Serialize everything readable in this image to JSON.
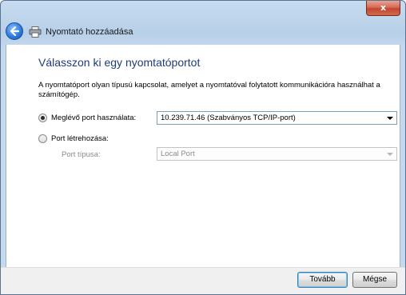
{
  "window": {
    "title": "Nyomtató hozzáadása",
    "close_label": "x"
  },
  "page": {
    "heading": "Válasszon ki egy nyomtatóportot",
    "description": "A nyomtatóport olyan típusú kapcsolat, amelyet a nyomtatóval folytatott kommunikációra használhat a számítógép."
  },
  "options": {
    "existing_port": {
      "label": "Meglévő port használata:",
      "selected": true,
      "value": "10.239.71.46 (Szabványos TCP/IP-port)"
    },
    "new_port": {
      "label": "Port létrehozása:",
      "selected": false,
      "type_label": "Port típusa:",
      "type_value": "Local Port"
    }
  },
  "footer": {
    "next_label": "Tovább",
    "cancel_label": "Mégse"
  }
}
